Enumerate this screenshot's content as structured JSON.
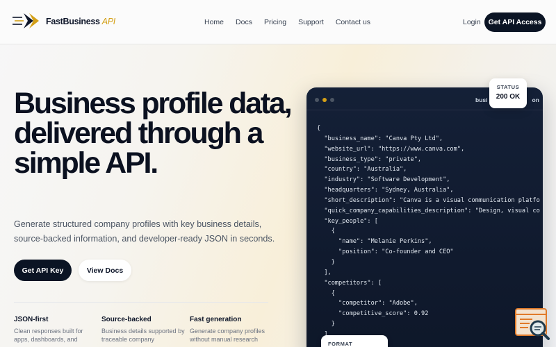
{
  "brand": {
    "name": "FastBusiness",
    "suffix": "API",
    "accent": "#d4a017"
  },
  "nav": {
    "links": [
      "Home",
      "Docs",
      "Pricing",
      "Support",
      "Contact us"
    ],
    "login": "Login",
    "cta": "Get API Access"
  },
  "hero": {
    "title": "Business profile data, delivered through a simple API.",
    "subtitle": "Generate structured company profiles with key business details, source-backed information, and developer-ready JSON in seconds.",
    "primary_button": "Get API Key",
    "secondary_button": "View Docs"
  },
  "features": [
    {
      "title": "JSON-first",
      "desc": "Clean responses built for apps, dashboards, and"
    },
    {
      "title": "Source-backed",
      "desc": "Business details supported by traceable company"
    },
    {
      "title": "Fast generation",
      "desc": "Generate company profiles without manual research"
    }
  ],
  "code_panel": {
    "label": "busi",
    "label_tail": "on",
    "lines": [
      "{",
      "  \"business_name\": \"Canva Pty Ltd\",",
      "  \"website_url\": \"https://www.canva.com\",",
      "  \"business_type\": \"private\",",
      "  \"country\": \"Australia\",",
      "  \"industry\": \"Software Development\",",
      "  \"headquarters\": \"Sydney, Australia\",",
      "  \"short_description\": \"Canva is a visual communication platfo",
      "  \"quick_company_capabilities_description\": \"Design, visual co",
      "  \"key_people\": [",
      "    {",
      "      \"name\": \"Melanie Perkins\",",
      "      \"position\": \"Co-founder and CEO\"",
      "    }",
      "  ],",
      "  \"competitors\": [",
      "    {",
      "      \"competitor\": \"Adobe\",",
      "      \"competitive_score\": 0.92",
      "    }",
      "  ]"
    ]
  },
  "status_card": {
    "label": "STATUS",
    "value": "200 OK"
  },
  "format_card": {
    "label": "FORMAT"
  },
  "icons": {
    "logo": "speed-arrow-icon",
    "chat": "chat-search-icon"
  }
}
